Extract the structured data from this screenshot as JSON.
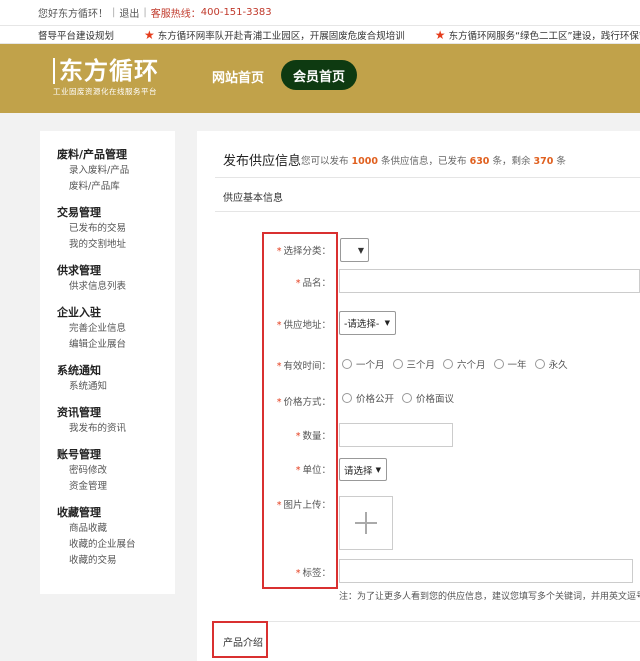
{
  "topbar": {
    "greeting": "您好东方循环！",
    "logout": "退出",
    "hotline_label": "客服热线：",
    "hotline_number": "400-151-3383"
  },
  "ticker": {
    "items": [
      "督导平台建设规划",
      "东方循环网率队开赴青浦工业园区，开展固废危废合规培训",
      "东方循环网服务“绿色二工区”建设，践行环保管"
    ]
  },
  "header": {
    "logo_main": "东方循环",
    "logo_sub": "工业固废资源化在线服务平台",
    "nav_home": "网站首页",
    "nav_member": "会员首页"
  },
  "sidebar": {
    "groups": [
      {
        "title": "废料/产品管理",
        "links": [
          "录入废料/产品",
          "废料/产品库"
        ]
      },
      {
        "title": "交易管理",
        "links": [
          "已发布的交易",
          "我的交割地址"
        ]
      },
      {
        "title": "供求管理",
        "links": [
          "供求信息列表"
        ]
      },
      {
        "title": "企业入驻",
        "links": [
          "完善企业信息",
          "编辑企业展台"
        ]
      },
      {
        "title": "系统通知",
        "links": [
          "系统通知"
        ]
      },
      {
        "title": "资讯管理",
        "links": [
          "我发布的资讯"
        ]
      },
      {
        "title": "账号管理",
        "links": [
          "密码修改",
          "资金管理"
        ]
      },
      {
        "title": "收藏管理",
        "links": [
          "商品收藏",
          "收藏的企业展台",
          "收藏的交易"
        ]
      }
    ]
  },
  "main": {
    "title": "发布供应信息",
    "sub_prefix": "您可以发布",
    "sub_total": "1000",
    "sub_mid": "条供应信息，已发布",
    "sub_published": "630",
    "sub_mid2": "条，剩余",
    "sub_remaining": "370",
    "sub_suffix": "条",
    "section_basic": "供应基本信息",
    "section_intro": "产品介绍"
  },
  "form": {
    "required_mark": "*",
    "category_label": "选择分类：",
    "name_label": "品名：",
    "address_label": "供应地址：",
    "address_select": "-请选择-",
    "validity_label": "有效时间：",
    "validity_options": [
      "一个月",
      "三个月",
      "六个月",
      "一年",
      "永久"
    ],
    "price_label": "价格方式：",
    "price_options": [
      "价格公开",
      "价格面议"
    ],
    "quantity_label": "数量：",
    "unit_label": "单位：",
    "unit_select": "请选择",
    "image_label": "图片上传：",
    "tags_label": "标签：",
    "note": "注：为了让更多人看到您的供应信息，建议您填写多个关键词，并用英文逗号"
  },
  "icons": {
    "star": "star-icon",
    "caret": "caret-down-icon",
    "plus": "plus-icon"
  },
  "colors": {
    "header_bg": "#c1a24a",
    "member_button": "#0e3a11",
    "highlight_box": "#d93030",
    "number_accent": "#e0601f",
    "star": "#e53c1c"
  }
}
